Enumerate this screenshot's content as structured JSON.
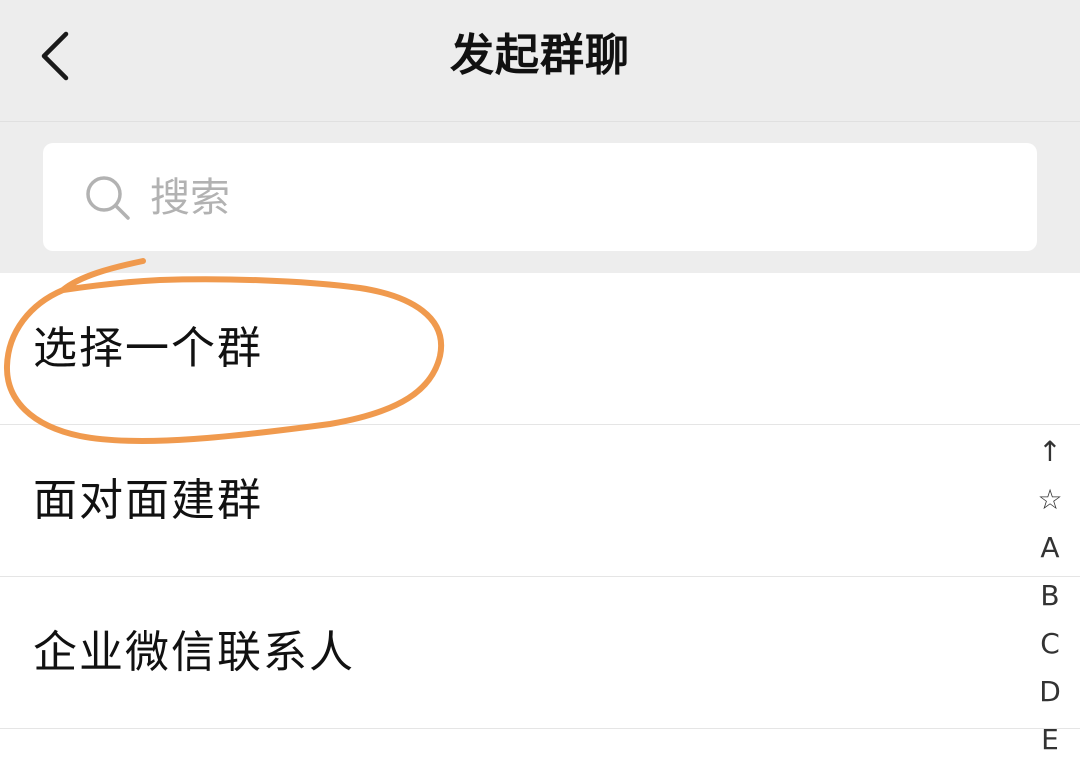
{
  "header": {
    "title": "发起群聊",
    "back_icon": "chevron-left-icon"
  },
  "search": {
    "placeholder": "搜索",
    "value": "",
    "icon": "search-icon"
  },
  "menu": {
    "items": [
      {
        "label": "选择一个群"
      },
      {
        "label": "面对面建群"
      },
      {
        "label": "企业微信联系人"
      }
    ]
  },
  "index_bar": {
    "items": [
      "↑",
      "☆",
      "A",
      "B",
      "C",
      "D",
      "E"
    ]
  },
  "colors": {
    "header_bg": "#ededed",
    "annotation": "#f09a4e",
    "text": "#111111",
    "placeholder": "#b2b2b2"
  }
}
